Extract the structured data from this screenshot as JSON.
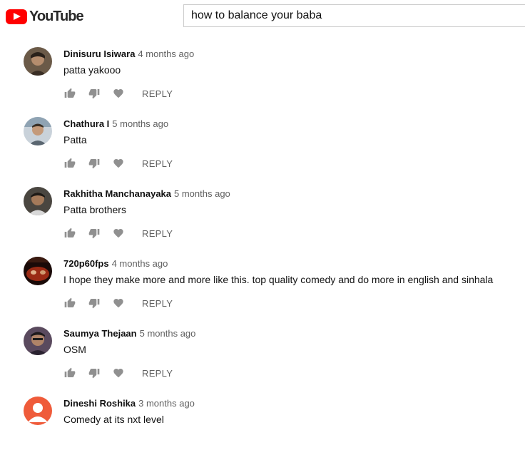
{
  "header": {
    "logo_text": "YouTube",
    "search_value": "how to balance your baba"
  },
  "actions": {
    "reply_label": "REPLY"
  },
  "colors": {
    "brand": "#ff0000",
    "icon": "#909090",
    "meta": "#606060"
  },
  "comments": [
    {
      "author": "Dinisuru Isiwara",
      "time": "4 months ago",
      "text": "patta yakooo",
      "avatar_color": "#5a4a3a"
    },
    {
      "author": "Chathura I",
      "time": "5 months ago",
      "text": "Patta",
      "avatar_color": "#8a9aa8"
    },
    {
      "author": "Rakhitha Manchanayaka",
      "time": "5 months ago",
      "text": "Patta brothers",
      "avatar_color": "#3d3a36"
    },
    {
      "author": "720p60fps",
      "time": "4 months ago",
      "text": "I hope they make more and more like this. top quality comedy and do more in english and sinhala",
      "avatar_color": "#7a1c12"
    },
    {
      "author": "Saumya Thejaan",
      "time": "5 months ago",
      "text": "OSM",
      "avatar_color": "#4a3a4e"
    },
    {
      "author": "Dineshi Roshika",
      "time": "3 months ago",
      "text": "Comedy at its nxt level",
      "avatar_color": "#ef5b3a"
    }
  ]
}
